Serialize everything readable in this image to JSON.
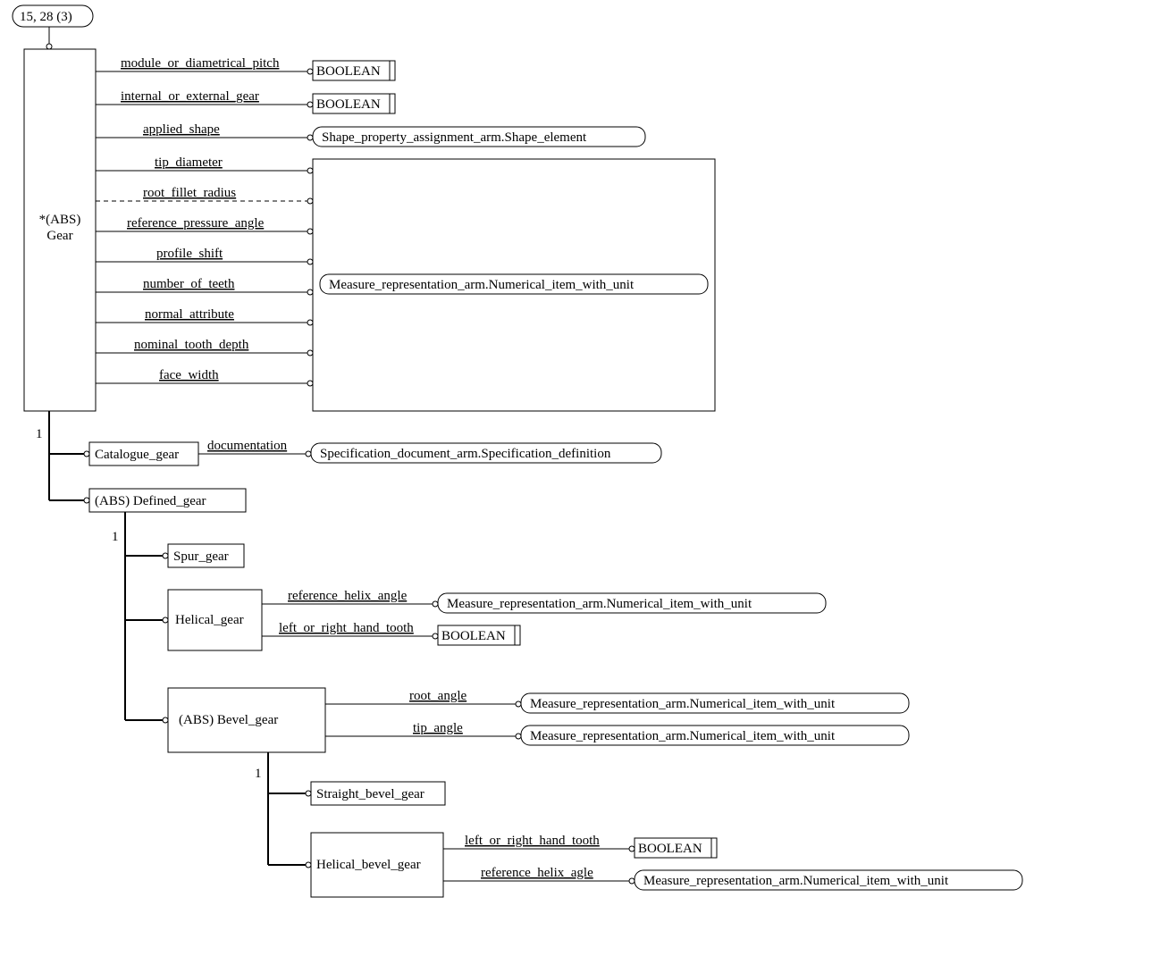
{
  "page_ref": "15, 28 (3)",
  "gear": {
    "name": "*(ABS)\nGear",
    "attrs": {
      "module_or_diametrical_pitch": "module_or_diametrical_pitch",
      "internal_or_external_gear": "internal_or_external_gear",
      "applied_shape": "applied_shape",
      "tip_diameter": "tip_diameter",
      "root_fillet_radius": "root_fillet_radius",
      "reference_pressure_angle": "reference_pressure_angle",
      "profile_shift": "profile_shift",
      "number_of_teeth": "number_of_teeth",
      "normal_attribute": "normal_attribute",
      "nominal_tooth_depth": "nominal_tooth_depth",
      "face_width": "face_width"
    }
  },
  "types": {
    "boolean": "BOOLEAN",
    "shape": "Shape_property_assignment_arm.Shape_element",
    "measure": "Measure_representation_arm.Numerical_item_with_unit",
    "spec": "Specification_document_arm.Specification_definition"
  },
  "catalogue": {
    "name": "Catalogue_gear",
    "attr_doc": "documentation"
  },
  "defined": "(ABS) Defined_gear",
  "spur": "Spur_gear",
  "helical": {
    "name": "Helical_gear",
    "ref_helix": "reference_helix_angle",
    "hand": "left_or_right_hand_tooth"
  },
  "bevel": {
    "name": "(ABS) Bevel_gear",
    "root": "root_angle",
    "tip": "tip_angle"
  },
  "straight_bevel": "Straight_bevel_gear",
  "helical_bevel": {
    "name": "Helical_bevel_gear",
    "hand": "left_or_right_hand_tooth",
    "ref": "reference_helix_agle"
  },
  "one": "1"
}
